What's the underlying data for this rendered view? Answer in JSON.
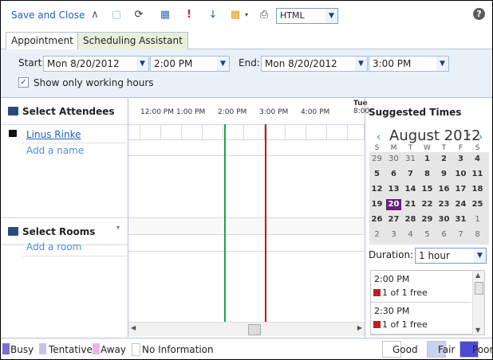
{
  "toolbar": {
    "save_label": "Save and Close",
    "format_value": "HTML",
    "help_label": "?"
  },
  "tabs": [
    {
      "label": "Appointment"
    },
    {
      "label": "Scheduling Assistant"
    }
  ],
  "times": {
    "start_label": "Start:",
    "start_date": "Mon 8/20/2012",
    "start_time": "2:00 PM",
    "end_label": "End:",
    "end_date": "Mon 8/20/2012",
    "end_time": "3:00 PM",
    "working_hours_label": "Show only working hours",
    "working_hours_checked": true
  },
  "attendees": {
    "title": "Select Attendees",
    "items": [
      {
        "name": "Linus Rinke"
      }
    ],
    "add_placeholder": "Add a name"
  },
  "rooms": {
    "title": "Select Rooms",
    "add_placeholder": "Add a room"
  },
  "grid": {
    "hours": [
      "12:00 PM",
      "1:00 PM",
      "2:00 PM",
      "3:00 PM",
      "4:00 PM"
    ],
    "next_day_label": "Tue",
    "next_day_time": "8:00"
  },
  "suggested": {
    "title": "Suggested Times",
    "month": "August 2012",
    "weekdays": [
      "S",
      "M",
      "T",
      "W",
      "T",
      "F",
      "S"
    ],
    "weeks": [
      [
        "29",
        "30",
        "31",
        "1",
        "2",
        "3",
        "4"
      ],
      [
        "5",
        "6",
        "7",
        "8",
        "9",
        "10",
        "11"
      ],
      [
        "12",
        "13",
        "14",
        "15",
        "16",
        "17",
        "18"
      ],
      [
        "19",
        "20",
        "21",
        "22",
        "23",
        "24",
        "25"
      ],
      [
        "26",
        "27",
        "28",
        "29",
        "30",
        "31",
        "1"
      ],
      [
        "2",
        "3",
        "4",
        "5",
        "6",
        "7",
        "8"
      ]
    ],
    "selected_day": "20",
    "duration_label": "Duration:",
    "duration_value": "1 hour",
    "slots": [
      {
        "time": "2:00 PM",
        "free": "1 of 1 free"
      },
      {
        "time": "2:30 PM",
        "free": "1 of 1 free"
      }
    ]
  },
  "legend": {
    "busy": "Busy",
    "tentative": "Tentative",
    "away": "Away",
    "noinfo": "No Information",
    "good": "Good",
    "fair": "Fair",
    "poor": "Poor"
  },
  "colors": {
    "busy": "#7c6fd1",
    "tentative": "#c9c2ee",
    "away": "#e8b6e6",
    "fair": "#c7d1f2",
    "poor": "#4c4ad1",
    "selected_day": "#68217a"
  }
}
